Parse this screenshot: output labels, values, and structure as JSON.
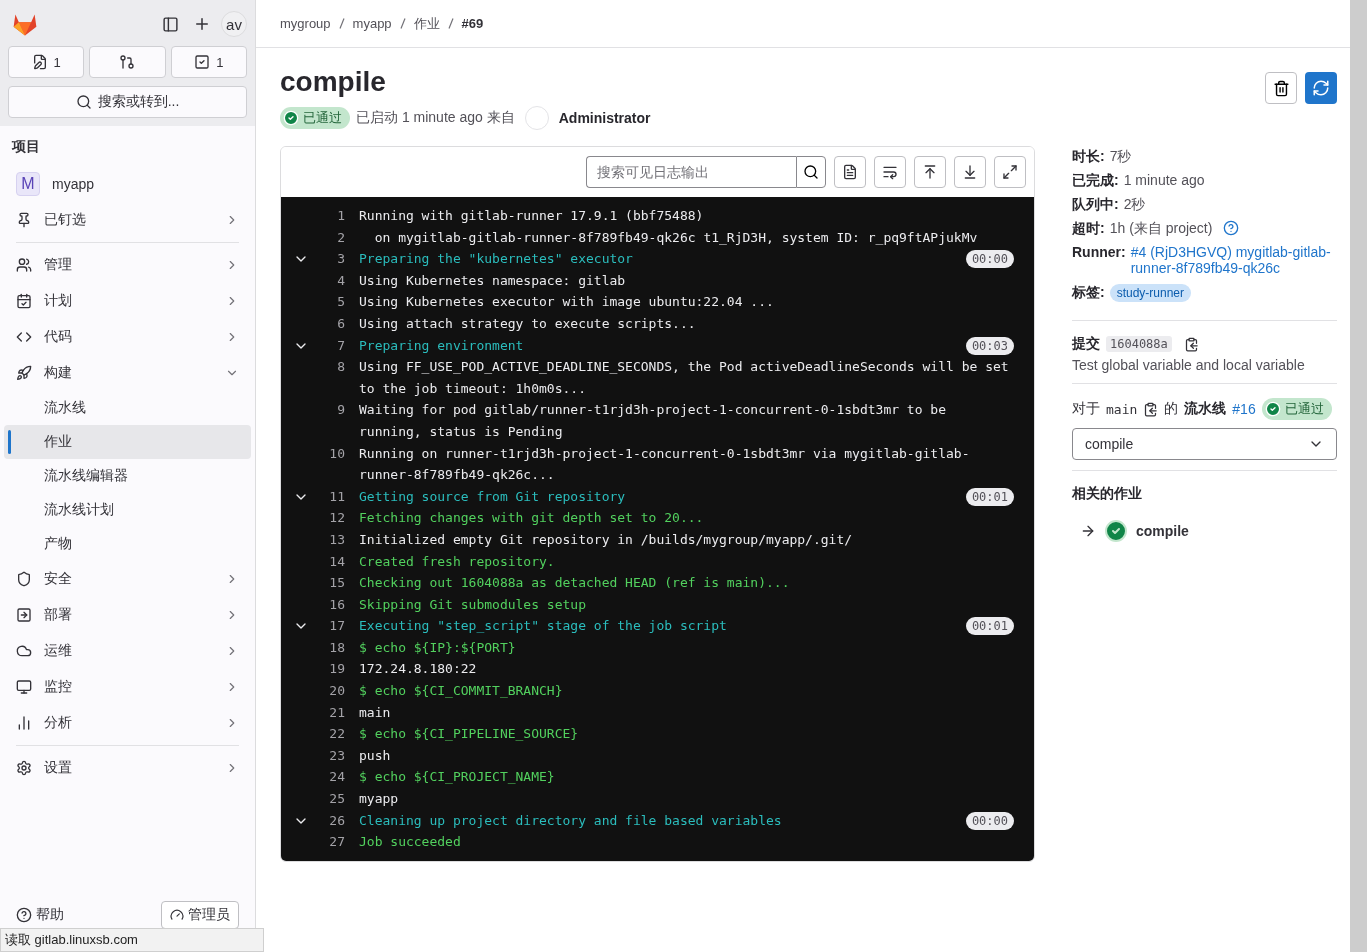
{
  "top_bar": {
    "avatar": "av",
    "counters": [
      {
        "kind": "issues",
        "count": "1"
      },
      {
        "kind": "merge_requests"
      },
      {
        "kind": "todos",
        "count": "1"
      }
    ],
    "search": {
      "placeholder": "搜索或转到..."
    }
  },
  "sidebar": {
    "section_title": "项目",
    "project": {
      "initial": "M",
      "name": "myapp"
    },
    "groups": [
      [
        {
          "label": "已钉选",
          "kind": "pin",
          "expanded": false
        }
      ],
      [
        {
          "label": "管理",
          "kind": "users",
          "expanded": false
        },
        {
          "label": "计划",
          "kind": "calendar",
          "expanded": false
        },
        {
          "label": "代码",
          "kind": "code",
          "expanded": false
        },
        {
          "label": "构建",
          "kind": "rocket",
          "expanded": true,
          "children": [
            {
              "label": "流水线",
              "selected": false
            },
            {
              "label": "作业",
              "selected": true
            },
            {
              "label": "流水线编辑器",
              "selected": false
            },
            {
              "label": "流水线计划",
              "selected": false
            },
            {
              "label": "产物",
              "selected": false
            }
          ]
        },
        {
          "label": "安全",
          "kind": "shield",
          "expanded": false
        },
        {
          "label": "部署",
          "kind": "deploy",
          "expanded": false
        },
        {
          "label": "运维",
          "kind": "cloud",
          "expanded": false
        },
        {
          "label": "监控",
          "kind": "monitor",
          "expanded": false
        },
        {
          "label": "分析",
          "kind": "chart",
          "expanded": false
        }
      ],
      [
        {
          "label": "设置",
          "kind": "settings",
          "expanded": false
        }
      ]
    ],
    "footer": {
      "help": "帮助",
      "admin": "管理员"
    }
  },
  "status_tooltip": "读取 gitlab.linuxsb.com",
  "breadcrumbs": [
    {
      "label": "mygroup",
      "current": false
    },
    {
      "label": "myapp",
      "current": false
    },
    {
      "label": "作业",
      "current": false
    },
    {
      "label": "#69",
      "current": true
    }
  ],
  "job": {
    "title": "compile",
    "status": {
      "kind": "passed",
      "label": "已通过"
    },
    "started": "已启动 1 minute ago 来自",
    "user": "Administrator"
  },
  "log": {
    "search_placeholder": "搜索可见日志输出",
    "lines": [
      {
        "number": "1",
        "text": "Running with gitlab-runner 17.9.1 (bbf75488)",
        "kind": "plain"
      },
      {
        "number": "2",
        "text": "  on mygitlab-gitlab-runner-8f789fb49-qk26c t1_RjD3H, system ID: r_pq9ftAPjukMv",
        "kind": "plain"
      },
      {
        "number": "3",
        "text": "Preparing the \"kubernetes\" executor",
        "kind": "section",
        "expanded": true,
        "duration": "00:00"
      },
      {
        "number": "4",
        "text": "Using Kubernetes namespace: gitlab",
        "kind": "plain"
      },
      {
        "number": "5",
        "text": "Using Kubernetes executor with image ubuntu:22.04 ...",
        "kind": "plain"
      },
      {
        "number": "6",
        "text": "Using attach strategy to execute scripts...",
        "kind": "plain"
      },
      {
        "number": "7",
        "text": "Preparing environment",
        "kind": "section",
        "expanded": true,
        "duration": "00:03"
      },
      {
        "number": "8",
        "text": "Using FF_USE_POD_ACTIVE_DEADLINE_SECONDS, the Pod activeDeadlineSeconds will be set to the job timeout: 1h0m0s...",
        "kind": "plain"
      },
      {
        "number": "9",
        "text": "Waiting for pod gitlab/runner-t1rjd3h-project-1-concurrent-0-1sbdt3mr to be running, status is Pending",
        "kind": "plain"
      },
      {
        "number": "10",
        "text": "Running on runner-t1rjd3h-project-1-concurrent-0-1sbdt3mr via mygitlab-gitlab-runner-8f789fb49-qk26c...",
        "kind": "plain"
      },
      {
        "number": "11",
        "text": "Getting source from Git repository",
        "kind": "section",
        "expanded": true,
        "duration": "00:01"
      },
      {
        "number": "12",
        "text": "Fetching changes with git depth set to 20...",
        "kind": "success"
      },
      {
        "number": "13",
        "text": "Initialized empty Git repository in /builds/mygroup/myapp/.git/",
        "kind": "plain"
      },
      {
        "number": "14",
        "text": "Created fresh repository.",
        "kind": "success"
      },
      {
        "number": "15",
        "text": "Checking out 1604088a as detached HEAD (ref is main)...",
        "kind": "success"
      },
      {
        "number": "16",
        "text": "Skipping Git submodules setup",
        "kind": "success"
      },
      {
        "number": "17",
        "text": "Executing \"step_script\" stage of the job script",
        "kind": "section",
        "expanded": true,
        "duration": "00:01"
      },
      {
        "number": "18",
        "text": "$ echo ${IP}:${PORT}",
        "kind": "success"
      },
      {
        "number": "19",
        "text": "172.24.8.180:22",
        "kind": "plain"
      },
      {
        "number": "20",
        "text": "$ echo ${CI_COMMIT_BRANCH}",
        "kind": "success"
      },
      {
        "number": "21",
        "text": "main",
        "kind": "plain"
      },
      {
        "number": "22",
        "text": "$ echo ${CI_PIPELINE_SOURCE}",
        "kind": "success"
      },
      {
        "number": "23",
        "text": "push",
        "kind": "plain"
      },
      {
        "number": "24",
        "text": "$ echo ${CI_PROJECT_NAME}",
        "kind": "success"
      },
      {
        "number": "25",
        "text": "myapp",
        "kind": "plain"
      },
      {
        "number": "26",
        "text": "Cleaning up project directory and file based variables",
        "kind": "section",
        "expanded": true,
        "duration": "00:00"
      },
      {
        "number": "27",
        "text": "Job succeeded",
        "kind": "success"
      }
    ]
  },
  "details": [
    {
      "label": "时长:",
      "value": "7秒",
      "kind": "text"
    },
    {
      "label": "已完成:",
      "value": "1 minute ago",
      "kind": "text"
    },
    {
      "label": "队列中:",
      "value": "2秒",
      "kind": "text"
    },
    {
      "label": "超时:",
      "value": "1h (来自 project)",
      "kind": "help"
    },
    {
      "label": "Runner:",
      "value": "#4 (RjD3HGVQ) mygitlab-gitlab-runner-8f789fb49-qk26c",
      "kind": "link"
    }
  ],
  "tags": {
    "label": "标签:",
    "items": [
      "study-runner"
    ]
  },
  "commit": {
    "label": "提交",
    "sha": "1604088a",
    "message": "Test global variable and local variable"
  },
  "pipeline": {
    "prefix": "对于",
    "branch": "main",
    "middle": "的",
    "label": "流水线",
    "number": "#16",
    "status": {
      "kind": "passed",
      "label": "已通过"
    }
  },
  "stage_select": {
    "value": "compile"
  },
  "related": {
    "title": "相关的作业",
    "jobs": [
      {
        "name": "compile"
      }
    ]
  }
}
